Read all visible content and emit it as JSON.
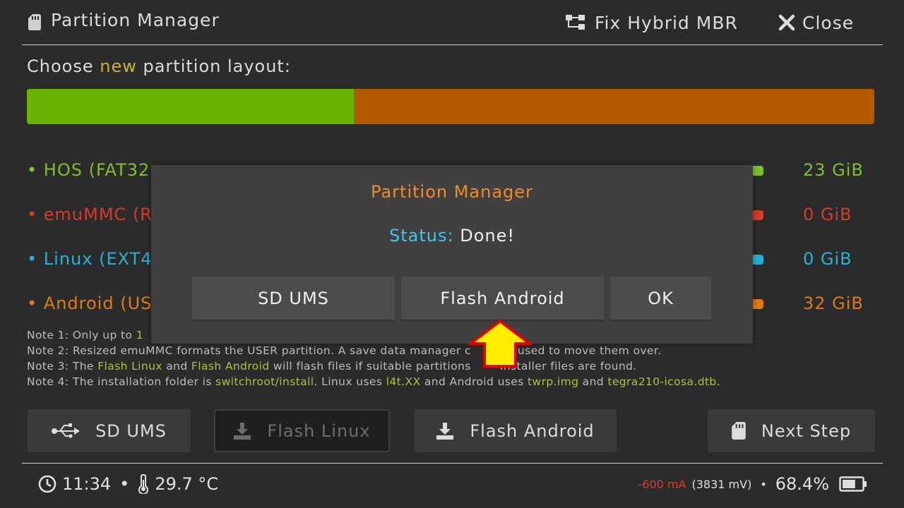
{
  "header": {
    "title": "Partition Manager",
    "fix_label": "Fix Hybrid MBR",
    "close_label": "Close"
  },
  "layout": {
    "label_prefix": "Choose ",
    "label_new": "new",
    "label_suffix": " partition layout:",
    "bar": [
      {
        "name": "HOS",
        "fraction": 0.386,
        "color": "#68b300"
      },
      {
        "name": "Android",
        "fraction": 0.614,
        "color": "#b35a00"
      }
    ]
  },
  "partitions": [
    {
      "label": "• HOS (FAT32",
      "size": "23 GiB",
      "color": "#80c02a"
    },
    {
      "label": "• emuMMC (R",
      "size": "0 GiB",
      "color": "#d23c2c"
    },
    {
      "label": "• Linux (EXT4)",
      "size": "0 GiB",
      "color": "#29b0d4"
    },
    {
      "label": "• Android (US",
      "size": "32 GiB",
      "color": "#e07a16"
    }
  ],
  "notes": {
    "n1a": "Note 1: Only up to ",
    "n1b": "1",
    "n2a": "Note 2: Resized emuMMC formats the USER partition. A save data manager c",
    "n2b": "used to move them over.",
    "n3a": "Note 3: The ",
    "n3b": "Flash Linux",
    "n3c": " and ",
    "n3d": "Flash Android",
    "n3e": " will flash files if suitable partitions ",
    "n3f": "installer files are found.",
    "n4a": "Note 4: The installation folder is ",
    "n4b": "switchroot/install",
    "n4c": ". Linux uses ",
    "n4d": "l4t.XX",
    "n4e": " and Android uses ",
    "n4f": "twrp.img",
    "n4g": " and ",
    "n4h": "tegra210-icosa.dtb",
    "n4i": "."
  },
  "buttons": {
    "sd_ums": "SD UMS",
    "flash_linux": "Flash Linux",
    "flash_android": "Flash Android",
    "next_step": "Next Step"
  },
  "status": {
    "time": "11:34",
    "sep": "•",
    "temp": "29.7 °C",
    "current": "-600 mA",
    "voltage": "(3831 mV)",
    "battery": "68.4%",
    "battery_fraction": 0.684
  },
  "dialog": {
    "title": "Partition Manager",
    "status_label": "Status:",
    "status_value": " Done!",
    "btn_sd_ums": "SD UMS",
    "btn_flash_android": "Flash Android",
    "btn_ok": "OK"
  },
  "colors": {
    "accent_orange": "#f08b27",
    "status_cyan": "#3fc6ea",
    "highlight_green": "#a6c637",
    "current_red": "#e03b2b",
    "arrow_yellow": "#ffee00",
    "arrow_red": "#e00000"
  },
  "icons": [
    "sd-card-icon",
    "hybrid-mbr-icon",
    "close-icon",
    "usb-icon",
    "download-icon",
    "clock-icon",
    "thermometer-icon",
    "battery-icon",
    "arrow-up-icon"
  ]
}
